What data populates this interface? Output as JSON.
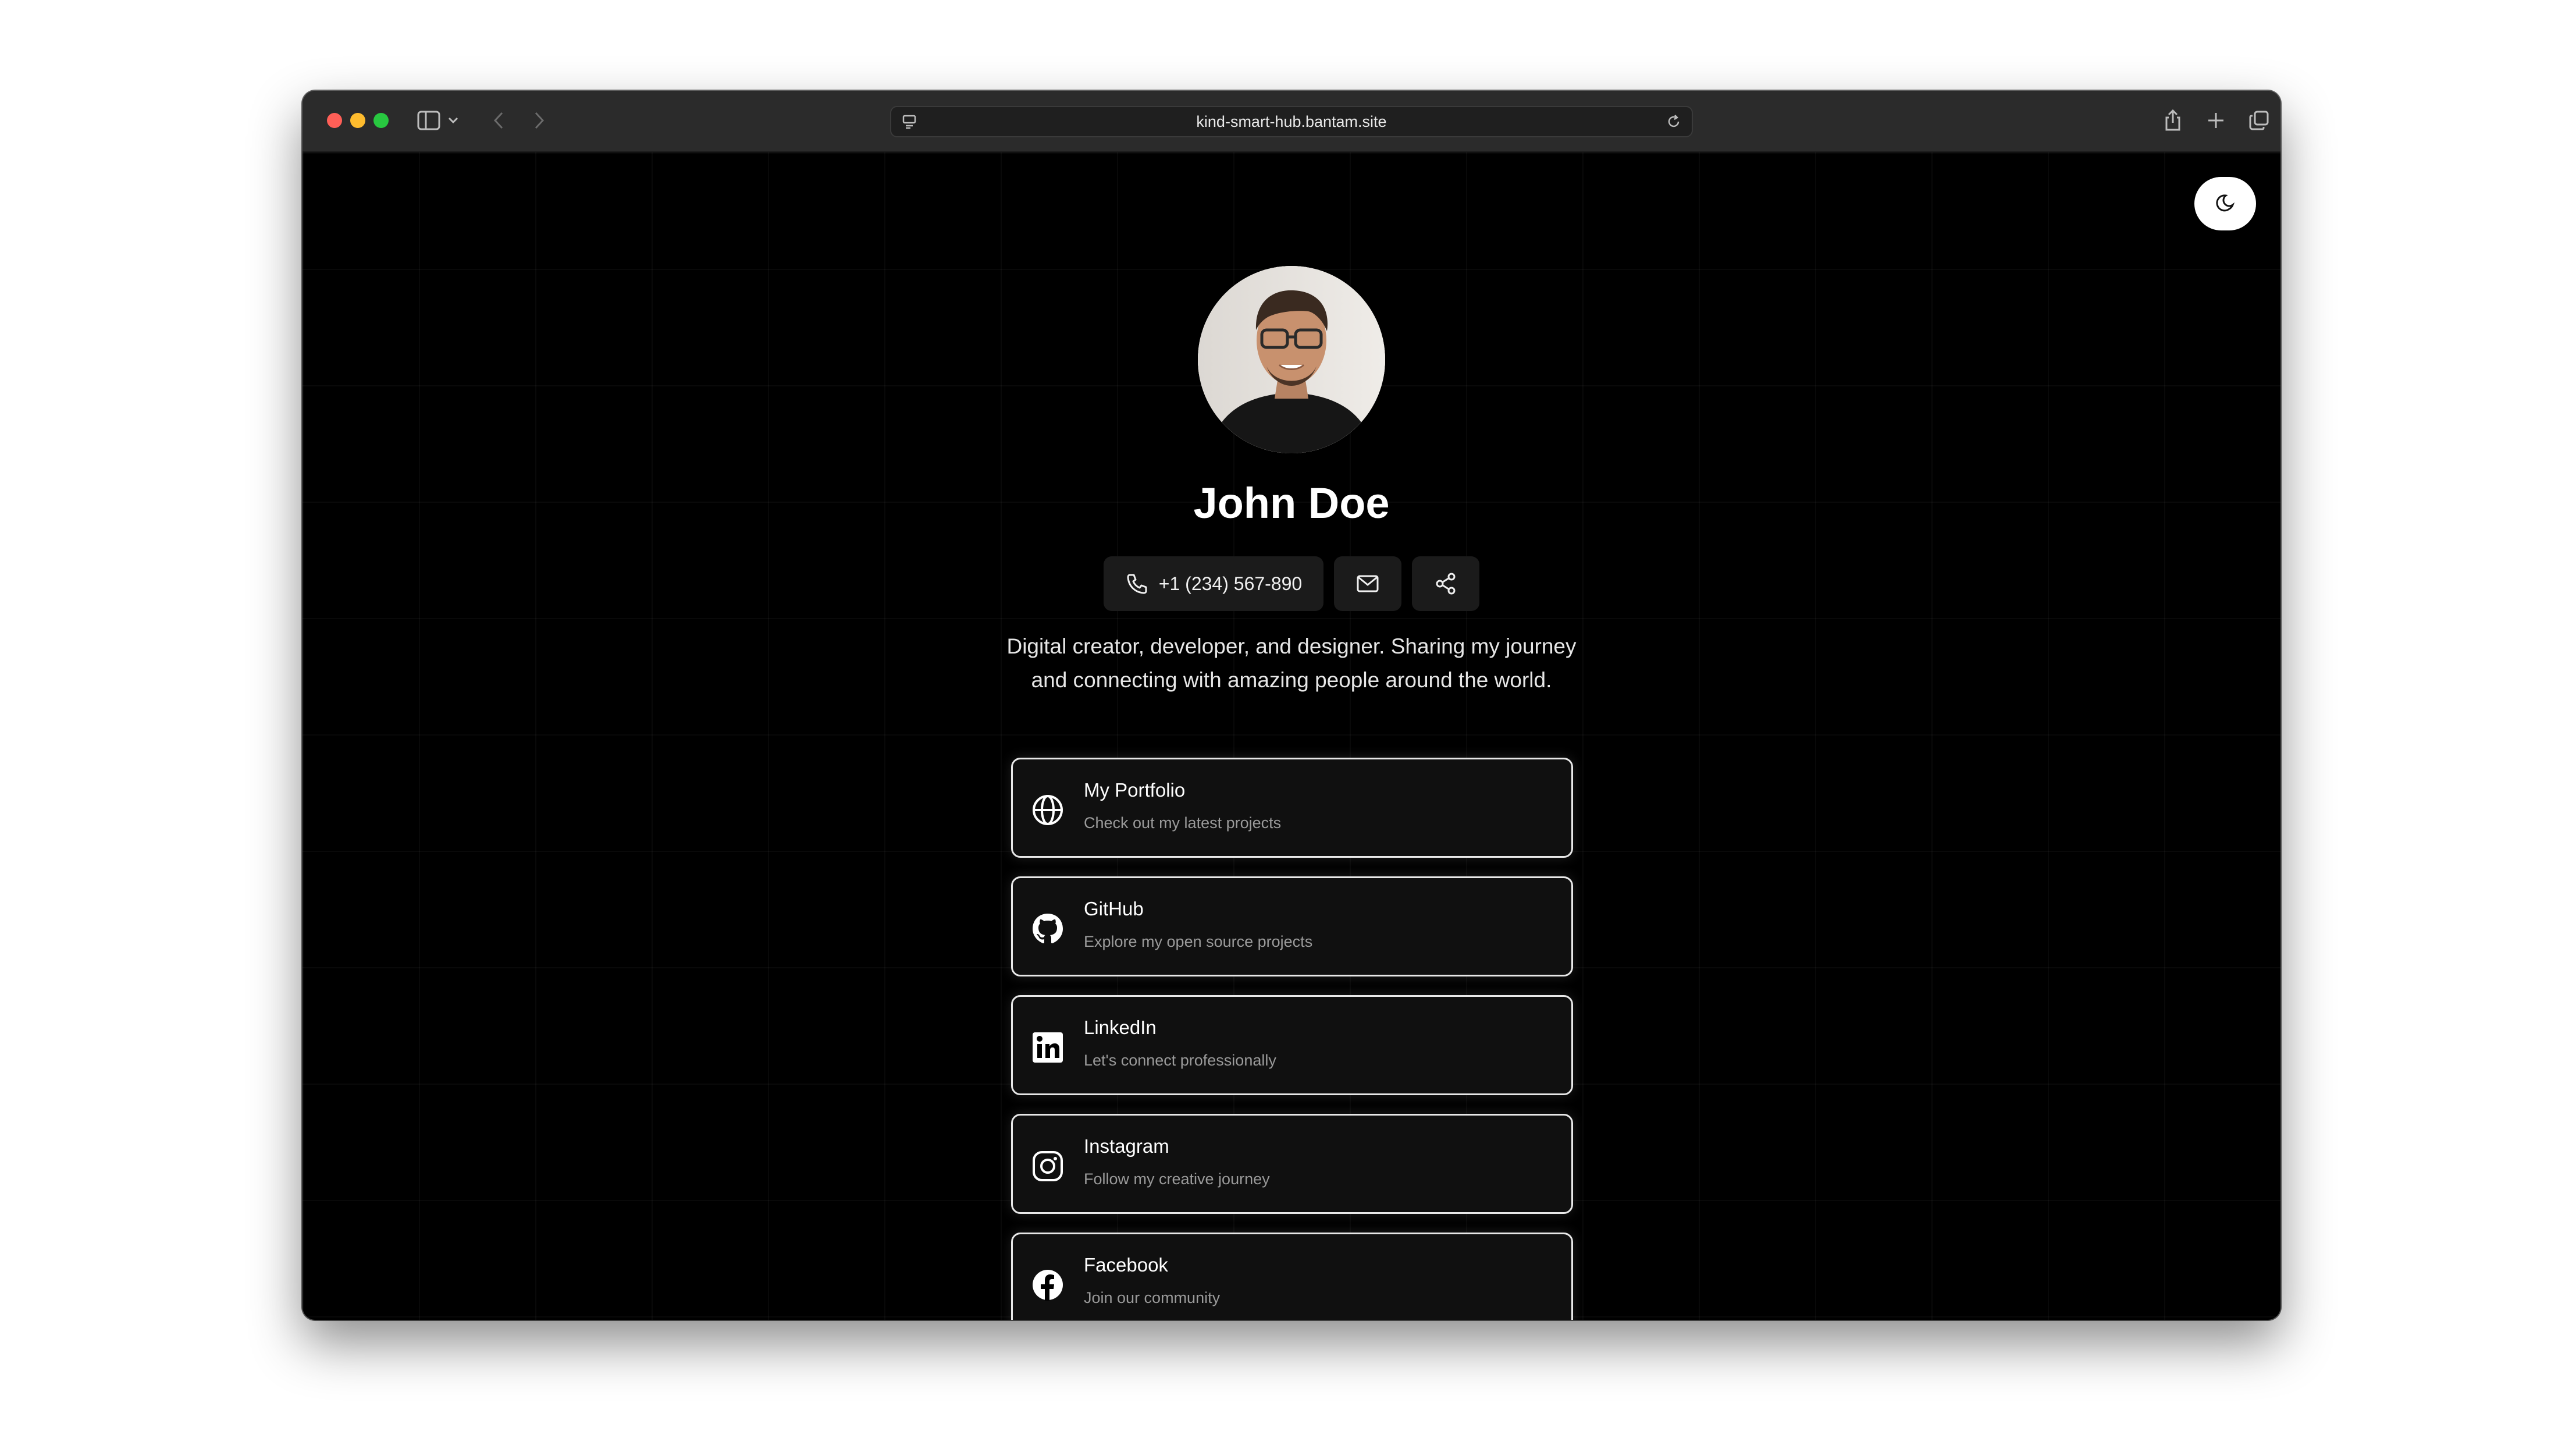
{
  "browser": {
    "url": "kind-smart-hub.bantam.site"
  },
  "profile": {
    "name": "John Doe",
    "phone": "+1 (234) 567-890",
    "bio": "Digital creator, developer, and designer. Sharing my journey and connecting with amazing people around the world."
  },
  "links": [
    {
      "title": "My Portfolio",
      "subtitle": "Check out my latest projects",
      "icon": "globe-icon"
    },
    {
      "title": "GitHub",
      "subtitle": "Explore my open source projects",
      "icon": "github-icon"
    },
    {
      "title": "LinkedIn",
      "subtitle": "Let's connect professionally",
      "icon": "linkedin-icon"
    },
    {
      "title": "Instagram",
      "subtitle": "Follow my creative journey",
      "icon": "instagram-icon"
    },
    {
      "title": "Facebook",
      "subtitle": "Join our community",
      "icon": "facebook-icon"
    }
  ],
  "colors": {
    "background": "#000000",
    "card_background": "#101010",
    "card_border": "#e8e8e8",
    "pill_background": "#1b1b1b"
  }
}
